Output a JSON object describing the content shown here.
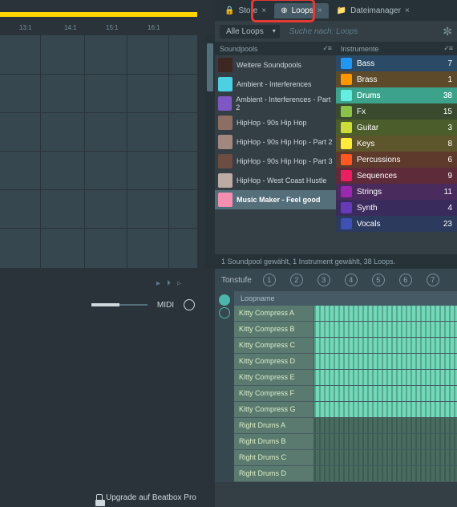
{
  "ruler": [
    "13:1",
    "14:1",
    "15:1",
    "16:1"
  ],
  "playback_icons": [
    "▸",
    "⏵",
    "▹"
  ],
  "midi_label": "MIDI",
  "upgrade": "Upgrade auf Beatbox Pro",
  "tabs": [
    {
      "icon": "🔒",
      "label": "Store",
      "close": "×"
    },
    {
      "icon": "⊕",
      "label": "Loops",
      "close": "×",
      "active": true
    },
    {
      "icon": "📁",
      "label": "Dateimanager",
      "close": "×"
    }
  ],
  "filter": {
    "dropdown": "Alle Loops",
    "search_placeholder": "Suche nach: Loops",
    "gear": "✼"
  },
  "soundpools": {
    "header": "Soundpools",
    "items": [
      {
        "label": "Weitere Soundpools",
        "thumb": "#3e2723"
      },
      {
        "label": "Ambient - Interferences",
        "thumb": "#4dd0e1"
      },
      {
        "label": "Ambient - Interferences - Part 2",
        "thumb": "#7e57c2"
      },
      {
        "label": "HipHop - 90s Hip Hop",
        "thumb": "#8d6e63"
      },
      {
        "label": "HipHop - 90s Hip Hop - Part 2",
        "thumb": "#a1887f"
      },
      {
        "label": "HipHop - 90s Hip Hop - Part 3",
        "thumb": "#6d4c41"
      },
      {
        "label": "HipHop - West Coast Hustle",
        "thumb": "#bcaaa4"
      },
      {
        "label": "Music Maker - Feel good",
        "thumb": "#f48fb1",
        "selected": true
      }
    ]
  },
  "instruments": {
    "header": "Instrumente",
    "items": [
      {
        "label": "Bass",
        "count": 7,
        "bg": "#2b4a66",
        "icon": "#2196f3"
      },
      {
        "label": "Brass",
        "count": 1,
        "bg": "#5d4a2b",
        "icon": "#ff9800"
      },
      {
        "label": "Drums",
        "count": 38,
        "bg": "#2e7d6b",
        "icon": "#4db6ac",
        "selected": true
      },
      {
        "label": "Fx",
        "count": 15,
        "bg": "#3a4a2e",
        "icon": "#8bc34a"
      },
      {
        "label": "Guitar",
        "count": 3,
        "bg": "#4a5d2b",
        "icon": "#cddc39"
      },
      {
        "label": "Keys",
        "count": 8,
        "bg": "#5d552b",
        "icon": "#ffeb3b"
      },
      {
        "label": "Percussions",
        "count": 6,
        "bg": "#5d3a2b",
        "icon": "#ff5722"
      },
      {
        "label": "Sequences",
        "count": 9,
        "bg": "#5d2b3a",
        "icon": "#e91e63"
      },
      {
        "label": "Strings",
        "count": 11,
        "bg": "#4a2b5d",
        "icon": "#9c27b0"
      },
      {
        "label": "Synth",
        "count": 4,
        "bg": "#3a2b5d",
        "icon": "#673ab7"
      },
      {
        "label": "Vocals",
        "count": 23,
        "bg": "#2b3a5d",
        "icon": "#3f51b5"
      }
    ]
  },
  "status": "1 Soundpool gewählt, 1 Instrument gewählt, 38 Loops.",
  "tonstufe": {
    "label": "Tonstufe",
    "steps": [
      1,
      2,
      3,
      4,
      5,
      6,
      7
    ]
  },
  "loops": {
    "header": "Loopname",
    "rows": [
      {
        "name": "Kitty Compress A",
        "dense": true
      },
      {
        "name": "Kitty Compress B",
        "dense": true
      },
      {
        "name": "Kitty Compress C",
        "dense": true
      },
      {
        "name": "Kitty Compress D",
        "dense": true
      },
      {
        "name": "Kitty Compress E",
        "dense": true
      },
      {
        "name": "Kitty Compress F",
        "dense": true
      },
      {
        "name": "Kitty Compress G",
        "dense": true
      },
      {
        "name": "Right Drums A",
        "dense": false
      },
      {
        "name": "Right Drums B",
        "dense": false
      },
      {
        "name": "Right Drums C",
        "dense": false
      },
      {
        "name": "Right Drums D",
        "dense": false
      }
    ]
  }
}
